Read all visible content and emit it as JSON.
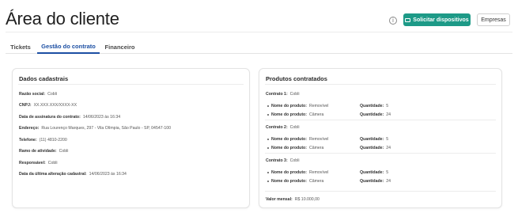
{
  "header": {
    "title": "Área do cliente",
    "primary_button": "Solicitar dispositivos",
    "secondary_button": "Empresas",
    "info_glyph": "i"
  },
  "tabs": [
    {
      "label": "Tickets"
    },
    {
      "label": "Gestão do contrato"
    },
    {
      "label": "Financeiro"
    }
  ],
  "active_tab": "Gestão do contrato",
  "dados": {
    "title": "Dados cadastrais",
    "fields": [
      {
        "label": "Razão social:",
        "value": "Cobli"
      },
      {
        "label": "CNPJ:",
        "value": "XX.XXX.XXX/XXXX-XX"
      },
      {
        "label": "Data de assinatura do contrato:",
        "value": "14/06/2023 às 16:34"
      },
      {
        "label": "Endereço:",
        "value": "Rua Lourenço Marques, 297 - Vila Olímpia, São Paulo - SP, 04547-100"
      },
      {
        "label": "Telefone:",
        "value": "(11) 4810-2200"
      },
      {
        "label": "Ramo de atividade:",
        "value": "Cobli"
      },
      {
        "label": "Responsável:",
        "value": "Cobli"
      },
      {
        "label": "Data da última alteração cadastral:",
        "value": "14/06/2023 às 16:34"
      }
    ]
  },
  "produtos": {
    "title": "Produtos contratados",
    "contracts": [
      {
        "label": "Contrato 1:",
        "value": "Cobli",
        "items": [
          {
            "name_label": "Nome do produto:",
            "name": "Removível",
            "qty_label": "Quantidade:",
            "qty": "5"
          },
          {
            "name_label": "Nome do produto:",
            "name": "Câmera",
            "qty_label": "Quantidade:",
            "qty": "24"
          }
        ]
      },
      {
        "label": "Contrato 2:",
        "value": "Cobli",
        "items": [
          {
            "name_label": "Nome do produto:",
            "name": "Removível",
            "qty_label": "Quantidade:",
            "qty": "5"
          },
          {
            "name_label": "Nome do produto:",
            "name": "Câmera",
            "qty_label": "Quantidade:",
            "qty": "24"
          }
        ]
      },
      {
        "label": "Contrato 3:",
        "value": "Cobli",
        "items": [
          {
            "name_label": "Nome do produto:",
            "name": "Removível",
            "qty_label": "Quantidade:",
            "qty": "5"
          },
          {
            "name_label": "Nome do produto:",
            "name": "Câmera",
            "qty_label": "Quantidade:",
            "qty": "24"
          }
        ]
      }
    ],
    "monthly_label": "Valor mensal:",
    "monthly_value": "R$ 10.000,00"
  },
  "colors": {
    "accent": "#1d9a87",
    "active_tab": "#1c4fa3"
  },
  "icons": {
    "info": "info-icon",
    "primary_button": "device-icon"
  }
}
